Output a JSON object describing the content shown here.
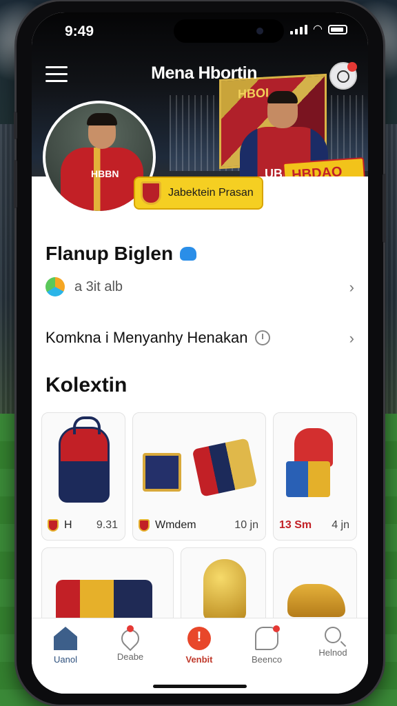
{
  "status_bar": {
    "time": "9:49"
  },
  "header": {
    "title": "Mena Hbortin"
  },
  "hero": {
    "flag_text": "HBOI",
    "player_shirt_text": "UBBJ",
    "promo_tag_text": "HBDAO",
    "photo_shirt_text": "HBBN",
    "name_badge": "Jabektein Prasan"
  },
  "profile": {
    "name": "Flanup Biglen",
    "rows": [
      {
        "label": "a 3it alb"
      },
      {
        "label": "Komkna i Menyanhy Henakan"
      }
    ]
  },
  "collection": {
    "title": "Kolextin",
    "items": [
      {
        "label": "H",
        "price": "9.31"
      },
      {
        "label": "Wmdem",
        "price": "10 jn"
      },
      {
        "label": "13 Sm",
        "price": "4 jn"
      }
    ]
  },
  "bottom_nav": [
    {
      "label": "Uanol"
    },
    {
      "label": "Deabe"
    },
    {
      "label": "Venbit"
    },
    {
      "label": "Beenco"
    },
    {
      "label": "Helnod"
    }
  ],
  "colors": {
    "accent": "#c22026",
    "gold": "#f5cf22",
    "nav_active": "#3d5f8a"
  }
}
